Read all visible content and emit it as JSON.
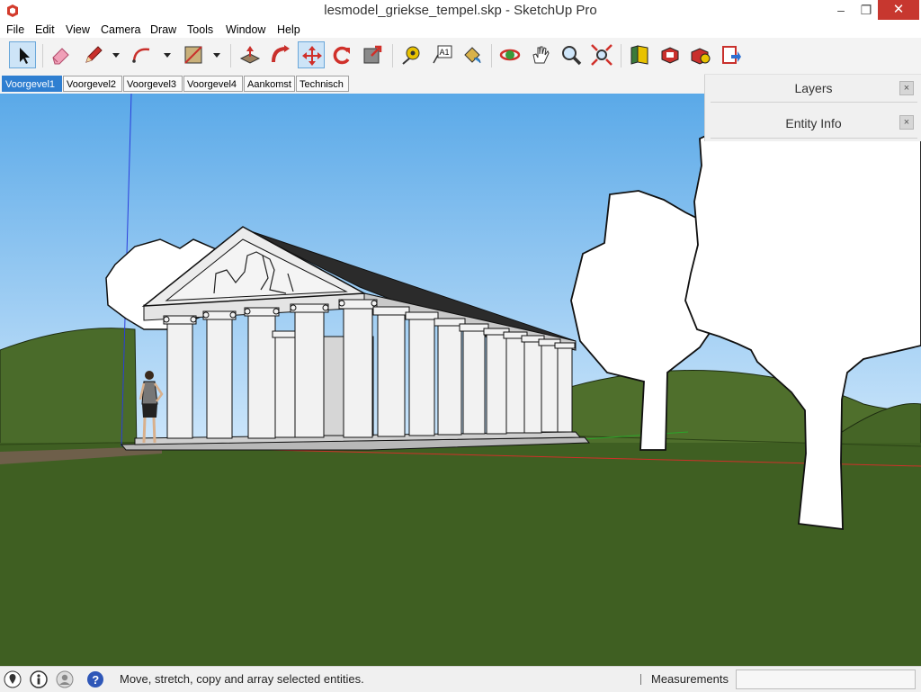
{
  "window": {
    "title": "lesmodel_griekse_tempel.skp - SketchUp Pro",
    "minimize": "–",
    "maximize": "❐",
    "close": "✕"
  },
  "menu": [
    "File",
    "Edit",
    "View",
    "Camera",
    "Draw",
    "Tools",
    "Window",
    "Help"
  ],
  "toolbar": {
    "tools": [
      "Select",
      "Eraser",
      "Line",
      "Arc",
      "Rectangle",
      "Push/Pull",
      "Follow Me",
      "Move",
      "Rotate",
      "Scale",
      "Tape Measure",
      "Text",
      "Paint Bucket",
      "Orbit",
      "Pan",
      "Zoom",
      "Zoom Extents",
      "3D Warehouse",
      "Extension Warehouse",
      "LayOut",
      "Send to LayOut"
    ],
    "active_tool": "Select"
  },
  "scenes": {
    "tabs": [
      "Voorgevel1",
      "Voorgevel2",
      "Voorgevel3",
      "Voorgevel4",
      "Aankomst",
      "Technisch"
    ],
    "active": "Voorgevel1"
  },
  "tray": {
    "panels": [
      {
        "title": "Layers",
        "close": "×"
      },
      {
        "title": "Entity Info",
        "close": "×"
      }
    ]
  },
  "status": {
    "message": "Move, stretch, copy and array selected entities.",
    "measurements_label": "Measurements",
    "measurements_value": ""
  },
  "colors": {
    "sky_top": "#5aa9e8",
    "sky_bottom": "#cfe7fb",
    "grass": "#3f5f22",
    "hills": "#4a6b2a",
    "accent": "#2f7fd1",
    "close_red": "#c7372f"
  }
}
